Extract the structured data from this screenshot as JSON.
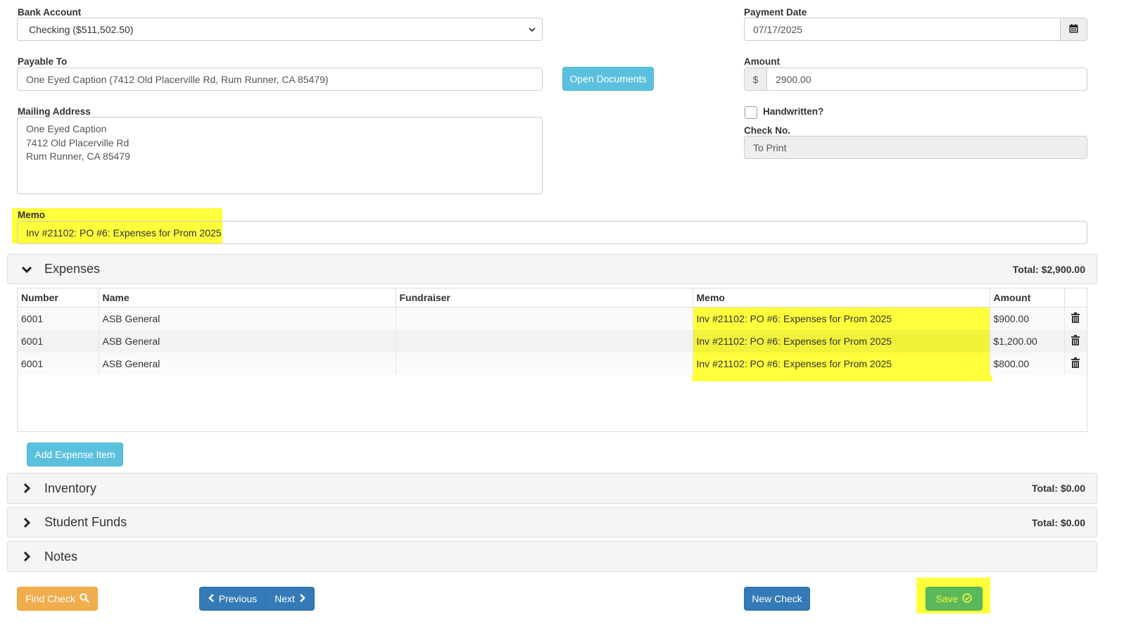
{
  "bank": {
    "label": "Bank Account",
    "value": "Checking ($511,502.50)"
  },
  "payment_date": {
    "label": "Payment Date",
    "value": "07/17/2025",
    "icon": "calendar-icon"
  },
  "payable": {
    "label": "Payable To",
    "value": "One Eyed Caption (7412 Old Placerville Rd, Rum Runner, CA 85479)"
  },
  "open_documents": "Open Documents",
  "amount": {
    "label": "Amount",
    "prefix": "$",
    "value": "2900.00"
  },
  "mailing": {
    "label": "Mailing Address",
    "lines": [
      "One Eyed Caption",
      "7412 Old Placerville Rd",
      "Rum Runner, CA 85479"
    ]
  },
  "handwritten": {
    "label": "Handwritten?",
    "checked": false
  },
  "check_no": {
    "label": "Check No.",
    "value": "To Print"
  },
  "memo": {
    "label": "Memo",
    "value": "Inv #21102: PO #6: Expenses for Prom 2025"
  },
  "expenses": {
    "title": "Expenses",
    "total": "Total: $2,900.00",
    "columns": [
      "Number",
      "Name",
      "Fundraiser",
      "Memo",
      "Amount"
    ],
    "rows": [
      {
        "number": "6001",
        "name": "ASB General",
        "fundraiser": "",
        "memo": "Inv #21102: PO #6: Expenses for Prom 2025",
        "amount": "$900.00"
      },
      {
        "number": "6001",
        "name": "ASB General",
        "fundraiser": "",
        "memo": "Inv #21102: PO #6: Expenses for Prom 2025",
        "amount": "$1,200.00"
      },
      {
        "number": "6001",
        "name": "ASB General",
        "fundraiser": "",
        "memo": "Inv #21102: PO #6: Expenses for Prom 2025",
        "amount": "$800.00"
      }
    ],
    "add_label": "Add Expense Item"
  },
  "inventory": {
    "title": "Inventory",
    "total": "Total: $0.00"
  },
  "student_funds": {
    "title": "Student Funds",
    "total": "Total: $0.00"
  },
  "notes": {
    "title": "Notes"
  },
  "footer": {
    "find_check": "Find Check",
    "previous": "Previous",
    "next": "Next",
    "new_check": "New Check",
    "save": "Save"
  },
  "colors": {
    "highlight": "#ffff3b",
    "info": "#5bc0de",
    "primary": "#337ab7",
    "warning": "#f0ad4e",
    "success": "#5cb85c"
  }
}
